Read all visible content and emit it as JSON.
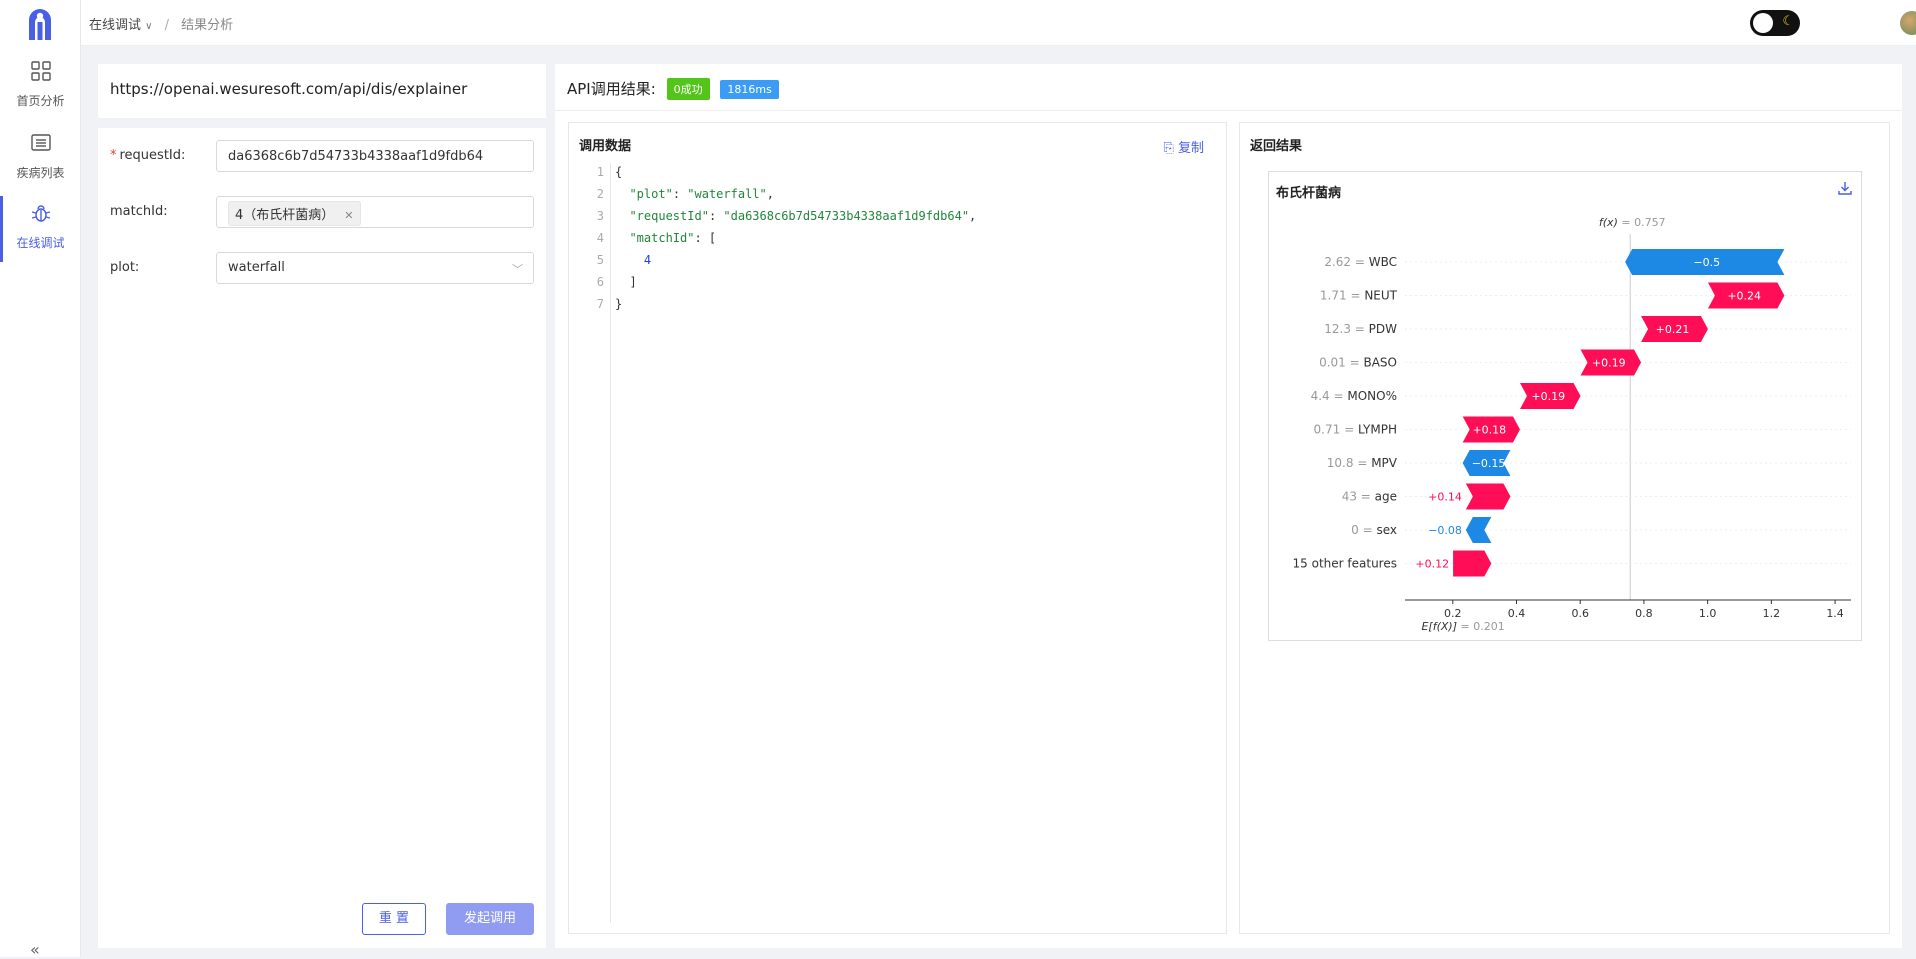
{
  "sidebar": {
    "items": [
      {
        "label": "首页分析",
        "icon": "grid-icon"
      },
      {
        "label": "疾病列表",
        "icon": "list-icon"
      },
      {
        "label": "在线调试",
        "icon": "bug-icon"
      }
    ],
    "collapse_icon": "double-chevron-left-icon"
  },
  "topbar": {
    "breadcrumb": [
      "在线调试",
      "结果分析"
    ],
    "theme_toggle_icon": "moon-icon"
  },
  "url_panel": {
    "url": "https://openai.wesuresoft.com/api/dis/explainer"
  },
  "form": {
    "request_id": {
      "label": "requestId:",
      "value": "da6368c6b7d54733b4338aaf1d9fdb64"
    },
    "match_id": {
      "label": "matchId:",
      "tag": "4（布氏杆菌病）"
    },
    "plot": {
      "label": "plot:",
      "value": "waterfall"
    },
    "reset_label": "重 置",
    "submit_label": "发起调用"
  },
  "result": {
    "title": "API调用结果:",
    "status_badge": "0成功",
    "time_badge": "1816ms",
    "request_panel": {
      "title": "调用数据",
      "copy_label": "复制",
      "lines": [
        "1",
        "2",
        "3",
        "4",
        "5",
        "6",
        "7"
      ]
    },
    "response_panel": {
      "title": "返回结果"
    }
  },
  "chart_data": {
    "type": "waterfall",
    "title": "布氏杆菌病",
    "fx_label": "f(x)",
    "fx": 0.757,
    "fx_text": "= 0.757",
    "efx_label": "E[f(X)]",
    "base": 0.201,
    "efx_text": "= 0.201",
    "xlim": [
      0.05,
      1.45
    ],
    "xticks": [
      0.2,
      0.4,
      0.6,
      0.8,
      1.0,
      1.2,
      1.4
    ],
    "xtick_labels": [
      "0.2",
      "0.4",
      "0.6",
      "0.8",
      "1.0",
      "1.2",
      "1.4"
    ],
    "colors": {
      "positive": "#ff0d57",
      "negative": "#1e88e5"
    },
    "features": [
      {
        "value": "2.62 =",
        "name": "WBC",
        "contribution": -0.5,
        "label": "−0.5"
      },
      {
        "value": "1.71 =",
        "name": "NEUT",
        "contribution": 0.24,
        "label": "+0.24"
      },
      {
        "value": "12.3 =",
        "name": "PDW",
        "contribution": 0.21,
        "label": "+0.21"
      },
      {
        "value": "0.01 =",
        "name": "BASO",
        "contribution": 0.19,
        "label": "+0.19"
      },
      {
        "value": "4.4 =",
        "name": "MONO%",
        "contribution": 0.19,
        "label": "+0.19"
      },
      {
        "value": "0.71 =",
        "name": "LYMPH",
        "contribution": 0.18,
        "label": "+0.18"
      },
      {
        "value": "10.8 =",
        "name": "MPV",
        "contribution": -0.15,
        "label": "−0.15"
      },
      {
        "value": "43 =",
        "name": "age",
        "contribution": 0.14,
        "label": "+0.14"
      },
      {
        "value": "0 =",
        "name": "sex",
        "contribution": -0.08,
        "label": "−0.08"
      },
      {
        "value": "",
        "name": "15 other features",
        "contribution": 0.12,
        "label": "+0.12"
      }
    ]
  }
}
